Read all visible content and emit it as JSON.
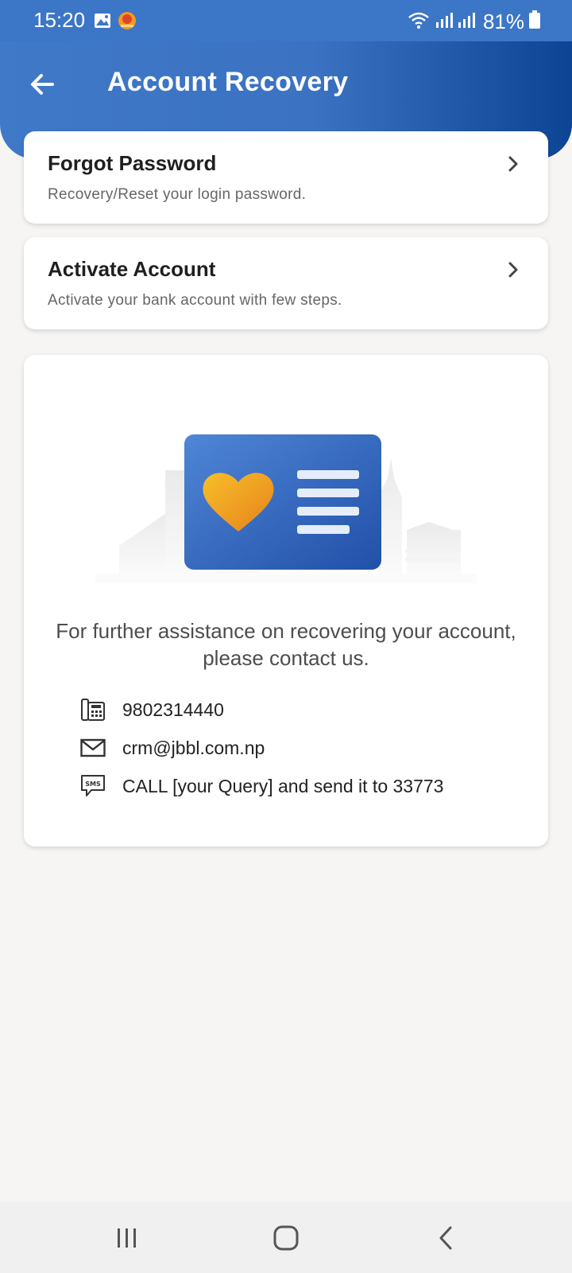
{
  "status_bar": {
    "time": "15:20",
    "battery": "81%"
  },
  "header": {
    "title": "Account Recovery"
  },
  "options": [
    {
      "title": "Forgot Password",
      "subtitle": "Recovery/Reset your login password."
    },
    {
      "title": "Activate Account",
      "subtitle": "Activate your bank account with few steps."
    }
  ],
  "assistance": {
    "message": "For further assistance on recovering your account, please contact us.",
    "phone": "9802314440",
    "email": "crm@jbbl.com.np",
    "sms": "CALL [your Query] and send it to 33773"
  },
  "colors": {
    "header_start": "#3f79c7",
    "header_end": "#0d4494",
    "card_blue": "#3e6fc4",
    "heart_orange": "#f0a21c"
  },
  "icons": {
    "back": "arrow-left-icon",
    "chevron": "chevron-right-icon",
    "phone": "fax-phone-icon",
    "email": "envelope-icon",
    "sms": "sms-bubble-icon"
  }
}
